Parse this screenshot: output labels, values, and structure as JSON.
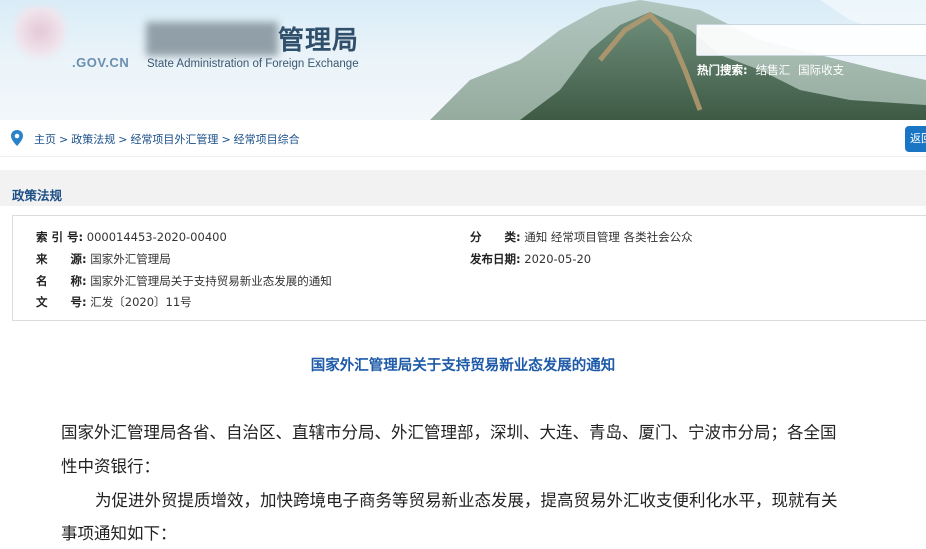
{
  "header": {
    "domain": ".GOV.CN",
    "title_visible": "管理局",
    "title_en": "State Administration of Foreign Exchange",
    "hot_search_label": "热门搜索:",
    "hot_search_items": [
      "结售汇",
      "国际收支"
    ]
  },
  "breadcrumb": {
    "items": [
      "主页",
      "政策法规",
      "经常项目外汇管理",
      "经常项目综合"
    ],
    "separator": ">",
    "return_label": "返回"
  },
  "section": {
    "title": "政策法规"
  },
  "info": {
    "index_label": "索 引 号:",
    "index_value": "000014453-2020-00400",
    "category_label": "分　　类:",
    "category_value": "通知  经常项目管理  各类社会公众",
    "source_label": "来　　源:",
    "source_value": "国家外汇管理局",
    "date_label": "发布日期:",
    "date_value": "2020-05-20",
    "name_label": "名　　称:",
    "name_value": "国家外汇管理局关于支持贸易新业态发展的通知",
    "doc_label": "文　　号:",
    "doc_value": "汇发〔2020〕11号"
  },
  "article": {
    "title": "国家外汇管理局关于支持贸易新业态发展的通知",
    "para1_line1": "国家外汇管理局各省、自治区、直辖市分局、外汇管理部，深圳、大连、青岛、厦门、宁波市分局；各全国",
    "para1_line2": "性中资银行：",
    "para2_line1": "为促进外贸提质增效，加快跨境电子商务等贸易新业态发展，提高贸易外汇收支便利化水平，现就有关",
    "para2_line2": "事项通知如下："
  },
  "colors": {
    "link_blue": "#1a4f8a",
    "title_blue": "#1e5aa8",
    "button_blue": "#1a75c4"
  }
}
